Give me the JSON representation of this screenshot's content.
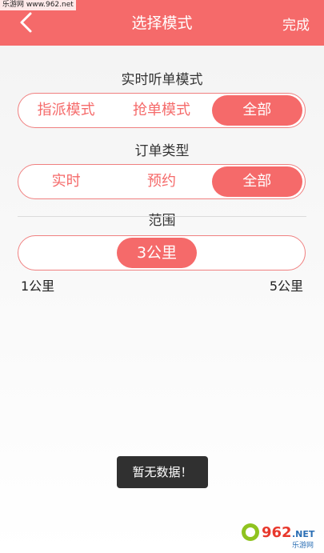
{
  "watermark": "乐游网 www.962.net",
  "header": {
    "title": "选择模式",
    "done_label": "完成"
  },
  "listen_mode": {
    "title": "实时听单模式",
    "options": [
      "指派模式",
      "抢单模式",
      "全部"
    ],
    "selected": "全部"
  },
  "order_type": {
    "title": "订单类型",
    "options": [
      "实时",
      "预约",
      "全部"
    ],
    "selected": "全部"
  },
  "range": {
    "title": "范围",
    "value_label": "3公里",
    "min_label": "1公里",
    "max_label": "5公里",
    "value": 3,
    "min": 1,
    "max": 5
  },
  "toast": "暂无数据！",
  "logo": {
    "number": "962",
    "suffix": ".NET",
    "sub": "乐游网"
  },
  "colors": {
    "accent": "#f56a6a",
    "border": "#f08080"
  }
}
